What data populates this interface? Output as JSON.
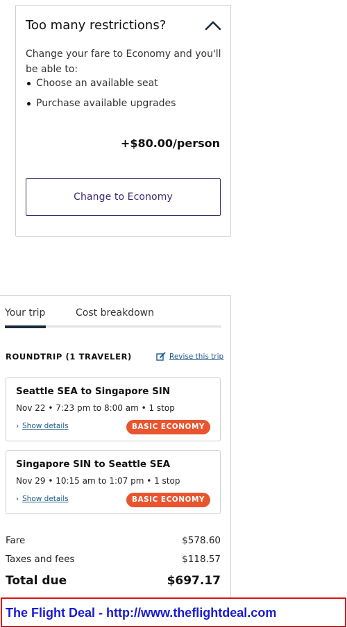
{
  "restrictions": {
    "title": "Too many restrictions?",
    "description": "Change your fare to Economy and you'll be able to:",
    "benefits": [
      "Choose an available seat",
      "Purchase available upgrades"
    ],
    "price": "+$80.00/person",
    "button_label": "Change to Economy",
    "icon": "chevron-up-icon"
  },
  "trip": {
    "tabs": [
      "Your trip",
      "Cost breakdown"
    ],
    "active_tab": "Your trip",
    "heading": "ROUNDTRIP (1 TRAVELER)",
    "revise_label": "Revise this trip",
    "flights": [
      {
        "route": "Seattle SEA to Singapore SIN",
        "details": "Nov 22 • 7:23 pm to 8:00 am • 1 stop",
        "show_details": "Show details",
        "badge": "BASIC ECONOMY"
      },
      {
        "route": "Singapore SIN to Seattle SEA",
        "details": "Nov 29 • 10:15 am to 1:07 pm • 1 stop",
        "show_details": "Show details",
        "badge": "BASIC ECONOMY"
      }
    ],
    "costs": {
      "fare_label": "Fare",
      "fare_value": "$578.60",
      "taxes_label": "Taxes and fees",
      "taxes_value": "$118.57",
      "total_label": "Total due",
      "total_value": "$697.17"
    }
  },
  "watermark": {
    "text": "The Flight Deal - http://www.theflightdeal.com"
  },
  "colors": {
    "accent": "#3d2a6e",
    "badge": "#e8552f",
    "link": "#1c5a8a",
    "tab_indicator": "#1b2b3a",
    "watermark_border": "#e01010",
    "watermark_text": "#1a1ad0"
  }
}
